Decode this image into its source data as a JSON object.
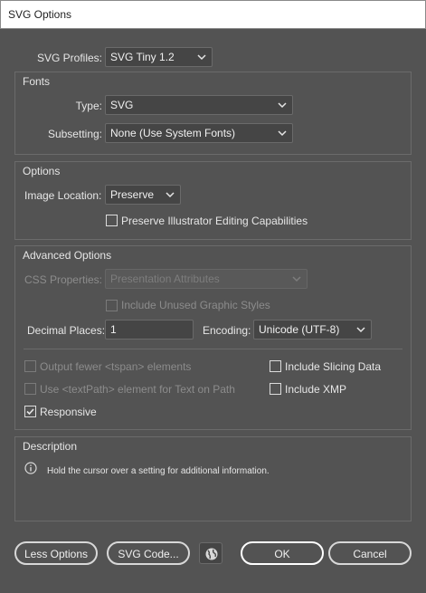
{
  "window": {
    "title": "SVG Options"
  },
  "profile": {
    "label": "SVG Profiles:",
    "value": "SVG Tiny 1.2"
  },
  "fonts": {
    "legend": "Fonts",
    "type_label": "Type:",
    "type_value": "SVG",
    "subsetting_label": "Subsetting:",
    "subsetting_value": "None (Use System Fonts)"
  },
  "options": {
    "legend": "Options",
    "image_location_label": "Image Location:",
    "image_location_value": "Preserve",
    "preserve_editing_label": "Preserve Illustrator Editing Capabilities",
    "preserve_editing_checked": false
  },
  "advanced": {
    "legend": "Advanced Options",
    "css_label": "CSS Properties:",
    "css_value": "Presentation Attributes",
    "unused_styles_label": "Include Unused Graphic Styles",
    "decimal_label": "Decimal Places:",
    "decimal_value": "1",
    "encoding_label": "Encoding:",
    "encoding_value": "Unicode (UTF-8)",
    "fewer_tspan_label": "Output fewer <tspan> elements",
    "textpath_label": "Use <textPath> element for Text on Path",
    "slicing_label": "Include Slicing Data",
    "xmp_label": "Include XMP",
    "responsive_label": "Responsive",
    "responsive_checked": true
  },
  "description": {
    "legend": "Description",
    "text": "Hold the cursor over a setting for additional information."
  },
  "buttons": {
    "less_options": "Less Options",
    "svg_code": "SVG Code...",
    "ok": "OK",
    "cancel": "Cancel"
  },
  "colors": {
    "background": "#535353",
    "field": "#454545",
    "border": "#6b6b6b"
  }
}
